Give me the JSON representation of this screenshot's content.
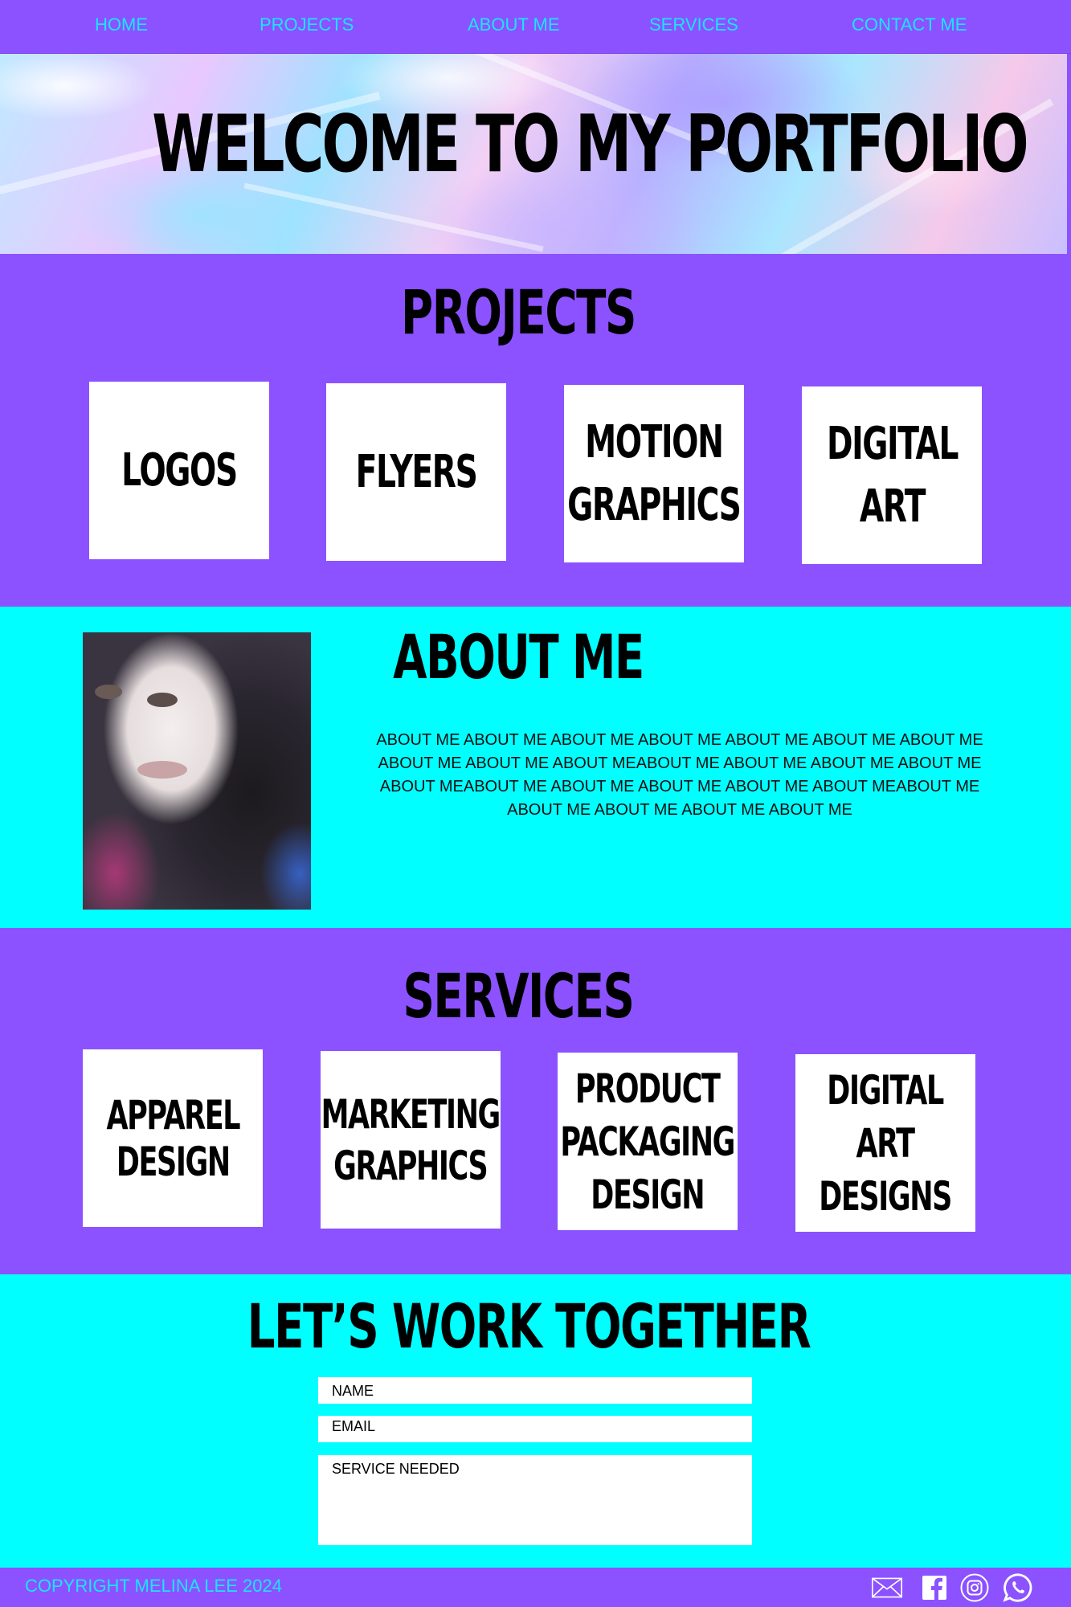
{
  "nav": {
    "items": [
      "HOME",
      "PROJECTS",
      "ABOUT ME",
      "SERVICES",
      "CONTACT ME"
    ]
  },
  "hero": {
    "title": "WELCOME TO MY PORTFOLIO"
  },
  "projects": {
    "heading": "PROJECTS",
    "cards": [
      "LOGOS",
      "FLYERS",
      "MOTION\nGRAPHICS",
      "DIGITAL\nART"
    ]
  },
  "about": {
    "heading": "ABOUT ME",
    "body": "ABOUT ME ABOUT ME ABOUT ME ABOUT ME ABOUT ME ABOUT ME ABOUT ME ABOUT ME ABOUT ME ABOUT MEABOUT ME ABOUT ME ABOUT ME ABOUT ME ABOUT MEABOUT ME ABOUT ME ABOUT ME ABOUT ME ABOUT MEABOUT ME ABOUT ME ABOUT ME ABOUT ME ABOUT ME"
  },
  "services": {
    "heading": "SERVICES",
    "cards": [
      "APPAREL\nDESIGN",
      "MARKETING\nGRAPHICS",
      "PRODUCT\nPACKAGING\nDESIGN",
      "DIGITAL\nART\nDESIGNS"
    ]
  },
  "contact": {
    "heading": "LET’S WORK TOGETHER",
    "name_label": "NAME",
    "email_label": "EMAIL",
    "service_label": "SERVICE NEEDED"
  },
  "footer": {
    "copyright": "COPYRIGHT MELINA LEE 2024",
    "icons": [
      "mail-icon",
      "facebook-icon",
      "instagram-icon",
      "whatsapp-icon"
    ]
  },
  "colors": {
    "purple": "#8c52ff",
    "cyan": "#00ffff",
    "nav_text": "#19e6ff"
  }
}
